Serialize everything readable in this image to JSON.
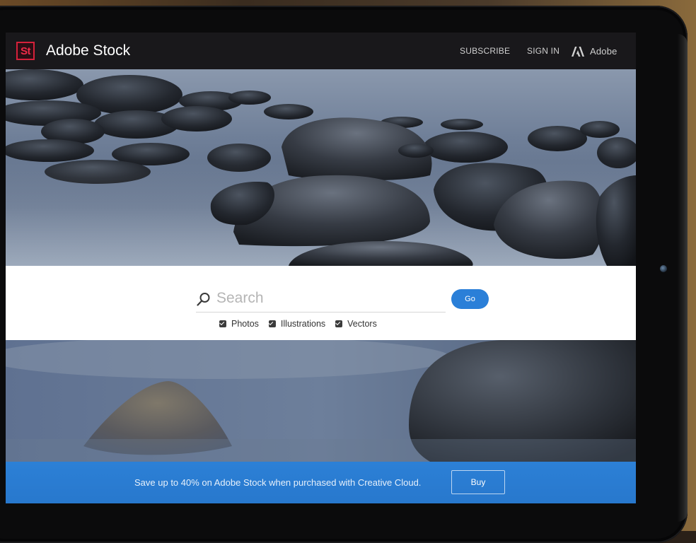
{
  "header": {
    "logo_badge": "St",
    "brand": "Adobe Stock",
    "nav": {
      "subscribe": "SUBSCRIBE",
      "sign_in": "SIGN IN",
      "adobe": "Adobe"
    }
  },
  "search": {
    "placeholder": "Search",
    "go_label": "Go",
    "filters": [
      {
        "label": "Photos",
        "checked": true
      },
      {
        "label": "Illustrations",
        "checked": true
      },
      {
        "label": "Vectors",
        "checked": true
      }
    ]
  },
  "promo": {
    "text": "Save up to 40% on Adobe Stock when purchased with Creative Cloud.",
    "buy_label": "Buy"
  },
  "colors": {
    "brand_red": "#d6213b",
    "accent_blue": "#2a7fd8",
    "header_bg": "#19181b"
  }
}
